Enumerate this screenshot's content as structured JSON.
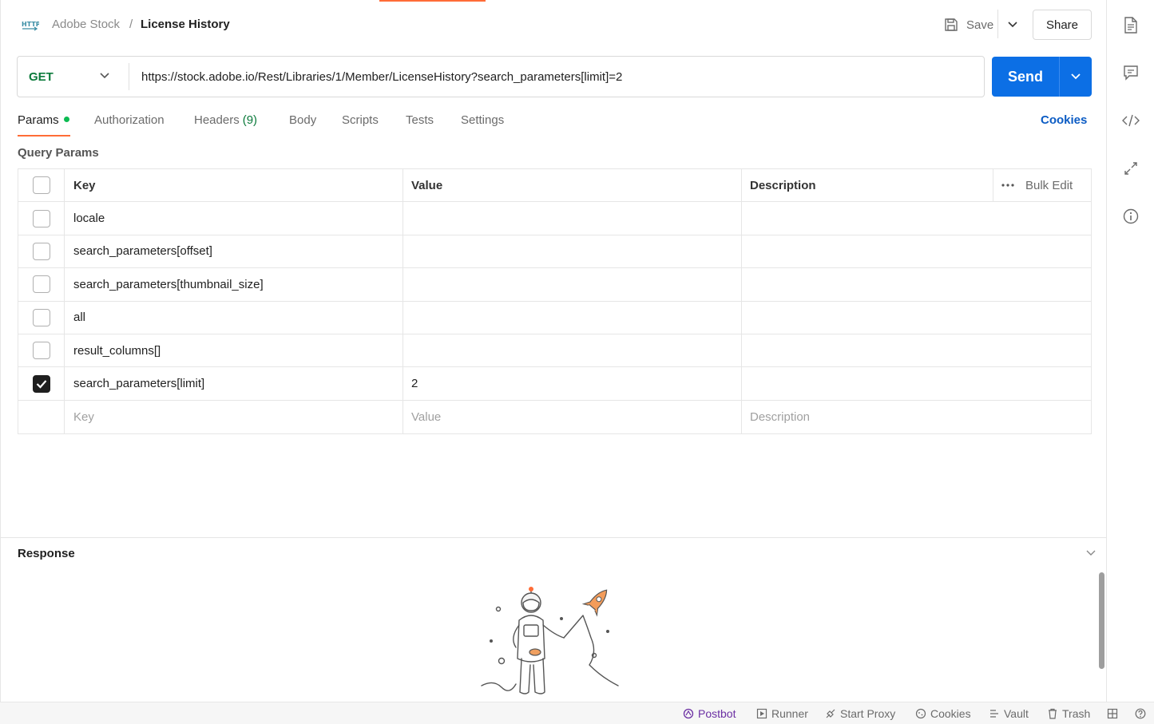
{
  "header": {
    "breadcrumb_parent": "Adobe Stock",
    "breadcrumb_sep": "/",
    "breadcrumb_current": "License History",
    "http_icon_label": "HTTP",
    "save_label": "Save",
    "share_label": "Share"
  },
  "request": {
    "method": "GET",
    "url": "https://stock.adobe.io/Rest/Libraries/1/Member/LicenseHistory?search_parameters[limit]=2",
    "send_label": "Send"
  },
  "tabs": [
    {
      "label": "Params",
      "active": true,
      "dot": true
    },
    {
      "label": "Authorization"
    },
    {
      "label": "Headers",
      "count": "(9)"
    },
    {
      "label": "Body"
    },
    {
      "label": "Scripts"
    },
    {
      "label": "Tests"
    },
    {
      "label": "Settings"
    }
  ],
  "cookies_link": "Cookies",
  "query_params": {
    "title": "Query Params",
    "headers": {
      "key": "Key",
      "value": "Value",
      "description": "Description",
      "bulk_edit": "Bulk Edit"
    },
    "rows": [
      {
        "key": "locale",
        "value": "",
        "checked": false
      },
      {
        "key": "search_parameters[offset]",
        "value": "",
        "checked": false
      },
      {
        "key": "search_parameters[thumbnail_size]",
        "value": "",
        "checked": false
      },
      {
        "key": "all",
        "value": "",
        "checked": false
      },
      {
        "key": "result_columns[]",
        "value": "",
        "checked": false
      },
      {
        "key": "search_parameters[limit]",
        "value": "2",
        "checked": true
      }
    ],
    "placeholders": {
      "key": "Key",
      "value": "Value",
      "description": "Description"
    }
  },
  "response": {
    "title": "Response"
  },
  "statusbar": [
    {
      "label": "Postbot",
      "icon": "postbot-icon"
    },
    {
      "label": "Runner",
      "icon": "runner-icon"
    },
    {
      "label": "Start Proxy",
      "icon": "proxy-icon"
    },
    {
      "label": "Cookies",
      "icon": "cookie-icon"
    },
    {
      "label": "Vault",
      "icon": "vault-icon"
    },
    {
      "label": "Trash",
      "icon": "trash-icon"
    }
  ],
  "colors": {
    "accent": "#ff6c37",
    "send": "#0c6fe5",
    "method_get": "#0b7a3b",
    "link": "#0c5cc4"
  }
}
